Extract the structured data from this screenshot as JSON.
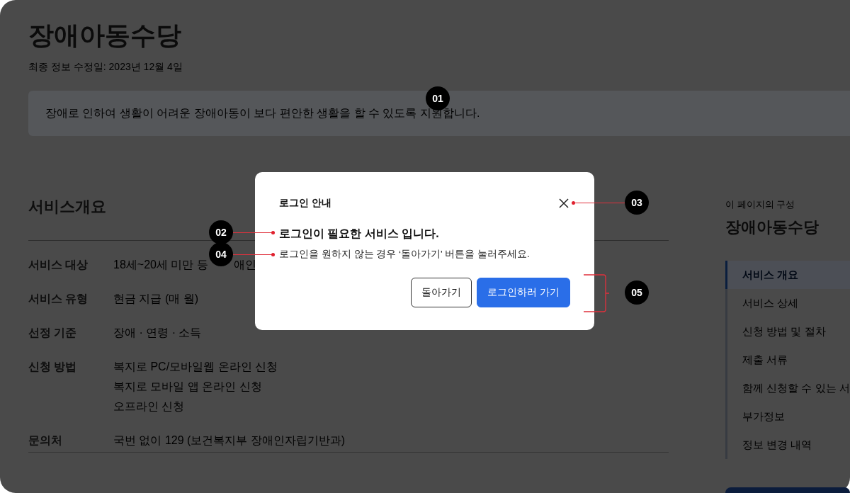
{
  "page": {
    "title": "장애아동수당",
    "updated": "최종 정보 수정일: 2023년 12월 4일",
    "summary": "장애로 인하여 생활이 어려운 장애아동이 보다 편안한 생활을 할 수 있도록 지원합니다."
  },
  "overview": {
    "heading": "서비스개요",
    "rows": [
      {
        "label": "서비스 대상",
        "values": [
          "18세~20세 미만 등"
        ],
        "tail": "애인"
      },
      {
        "label": "서비스 유형",
        "values": [
          "현금 지급 (매 월)"
        ]
      },
      {
        "label": "선정 기준",
        "values": [
          "장애 · 연령 · 소득"
        ]
      },
      {
        "label": "신청 방법",
        "values": [
          "복지로 PC/모바일웹 온라인 신청",
          "복지로 모바일 앱 온라인 신청",
          "오프라인 신청"
        ]
      },
      {
        "label": "문의처",
        "values": [
          "국번 없이 129 (보건복지부 장애인자립기반과)"
        ]
      }
    ]
  },
  "toc": {
    "caption": "이 페이지의 구성",
    "title": "장애아동수당",
    "items": [
      {
        "label": "서비스 개요",
        "selected": true
      },
      {
        "label": "서비스 상세",
        "selected": false
      },
      {
        "label": "신청 방법 및 절차",
        "selected": false
      },
      {
        "label": "제출 서류",
        "selected": false
      },
      {
        "label": "함께 신청할 수 있는 서",
        "selected": false
      },
      {
        "label": "부가정보",
        "selected": false
      },
      {
        "label": "정보 변경 내역",
        "selected": false
      }
    ]
  },
  "modal": {
    "title": "로그인 안내",
    "heading": "로그인이 필요한 서비스 입니다.",
    "message": "로그인을 원하지 않는 경우 ‘돌아가기' 버튼을 눌러주세요.",
    "buttons": [
      {
        "label": "돌아가기",
        "kind": "secondary"
      },
      {
        "label": "로그인하러 가기",
        "kind": "primary"
      }
    ]
  },
  "annotations": [
    {
      "label": "01"
    },
    {
      "label": "02"
    },
    {
      "label": "03"
    },
    {
      "label": "04"
    },
    {
      "label": "05"
    }
  ]
}
